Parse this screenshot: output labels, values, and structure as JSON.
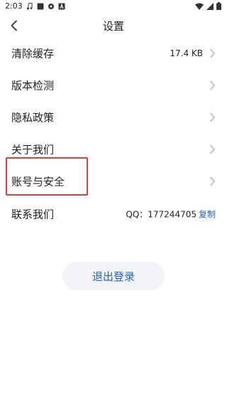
{
  "status_bar": {
    "time": "2:03",
    "icons": [
      "music-note-icon",
      "media-square-icon",
      "circle-dot-icon",
      "a-badge-icon",
      "wifi-icon",
      "signal-icon",
      "battery-icon"
    ]
  },
  "header": {
    "title": "设置",
    "back_icon": "chevron-left-icon"
  },
  "settings": {
    "items": [
      {
        "label": "清除缓存",
        "value": "17.4 KB"
      },
      {
        "label": "版本检测"
      },
      {
        "label": "隐私政策"
      },
      {
        "label": "关于我们"
      },
      {
        "label": "账号与安全",
        "highlighted": true
      },
      {
        "label": "联系我们",
        "value": "QQ：177244705",
        "action": "复制"
      }
    ]
  },
  "logout": {
    "label": "退出登录"
  },
  "colors": {
    "accent": "#1e63c8",
    "highlight": "#d9413a",
    "button_bg": "#f2f4f7"
  }
}
